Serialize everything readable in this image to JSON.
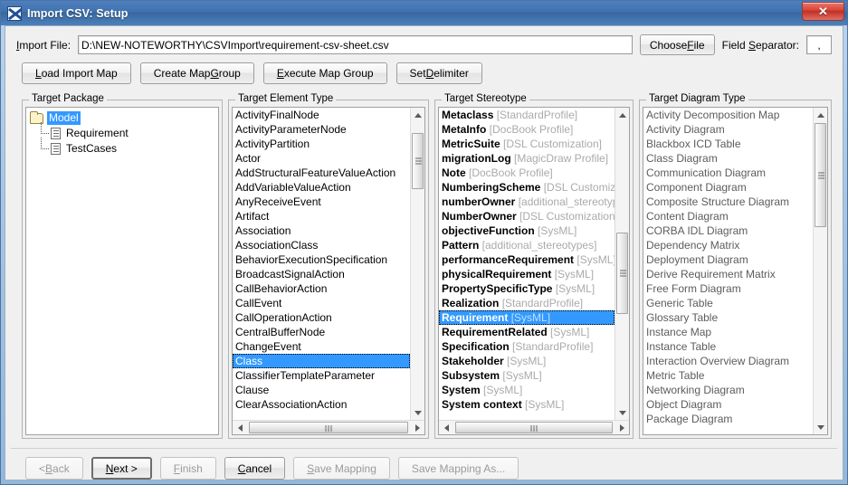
{
  "window": {
    "title": "Import CSV: Setup",
    "icon": "magicdraw-logo-icon",
    "close_label": "✕"
  },
  "form": {
    "import_file_label": "Import File:",
    "import_file_value": "D:\\NEW-NOTEWORTHY\\CSVImport\\requirement-csv-sheet.csv",
    "import_file_placeholder": "",
    "choose_file_label": "Choose File",
    "field_separator_label": "Field Separator:",
    "field_separator_value": ","
  },
  "toolbar": {
    "buttons": [
      {
        "label": "Load Import Map",
        "enabled": true
      },
      {
        "label": "Create Map Group",
        "enabled": true
      },
      {
        "label": "Execute Map Group",
        "enabled": true
      },
      {
        "label": "Set Delimiter",
        "enabled": true
      }
    ]
  },
  "panels": {
    "target_package": {
      "legend": "Target Package",
      "tree": [
        {
          "label": "Model",
          "icon": "folder-icon",
          "selected": true,
          "depth": 0
        },
        {
          "label": "Requirement",
          "icon": "document-icon",
          "selected": false,
          "depth": 1
        },
        {
          "label": "TestCases",
          "icon": "document-icon",
          "selected": false,
          "depth": 1
        }
      ]
    },
    "target_element_type": {
      "legend": "Target Element Type",
      "items": [
        {
          "name": "ActivityFinalNode"
        },
        {
          "name": "ActivityParameterNode"
        },
        {
          "name": "ActivityPartition"
        },
        {
          "name": "Actor"
        },
        {
          "name": "AddStructuralFeatureValueAction"
        },
        {
          "name": "AddVariableValueAction"
        },
        {
          "name": "AnyReceiveEvent"
        },
        {
          "name": "Artifact"
        },
        {
          "name": "Association"
        },
        {
          "name": "AssociationClass"
        },
        {
          "name": "BehaviorExecutionSpecification"
        },
        {
          "name": "BroadcastSignalAction"
        },
        {
          "name": "CallBehaviorAction"
        },
        {
          "name": "CallEvent"
        },
        {
          "name": "CallOperationAction"
        },
        {
          "name": "CentralBufferNode"
        },
        {
          "name": "ChangeEvent"
        },
        {
          "name": "Class",
          "selected": true
        },
        {
          "name": "ClassifierTemplateParameter"
        },
        {
          "name": "Clause"
        },
        {
          "name": "ClearAssociationAction"
        }
      ]
    },
    "target_stereotype": {
      "legend": "Target Stereotype",
      "items": [
        {
          "name": "Metaclass",
          "profile": "[StandardProfile]"
        },
        {
          "name": "MetaInfo",
          "profile": "[DocBook Profile]"
        },
        {
          "name": "MetricSuite",
          "profile": "[DSL Customization]"
        },
        {
          "name": "migrationLog",
          "profile": "[MagicDraw Profile]"
        },
        {
          "name": "Note",
          "profile": "[DocBook Profile]"
        },
        {
          "name": "NumberingScheme",
          "profile": "[DSL Customization]"
        },
        {
          "name": "numberOwner",
          "profile": "[additional_stereotypes]"
        },
        {
          "name": "NumberOwner",
          "profile": "[DSL Customization]"
        },
        {
          "name": "objectiveFunction",
          "profile": "[SysML]"
        },
        {
          "name": "Pattern",
          "profile": "[additional_stereotypes]"
        },
        {
          "name": "performanceRequirement",
          "profile": "[SysML]"
        },
        {
          "name": "physicalRequirement",
          "profile": "[SysML]"
        },
        {
          "name": "PropertySpecificType",
          "profile": "[SysML]"
        },
        {
          "name": "Realization",
          "profile": "[StandardProfile]"
        },
        {
          "name": "Requirement",
          "profile": "[SysML]",
          "selected": true
        },
        {
          "name": "RequirementRelated",
          "profile": "[SysML]"
        },
        {
          "name": "Specification",
          "profile": "[StandardProfile]"
        },
        {
          "name": "Stakeholder",
          "profile": "[SysML]"
        },
        {
          "name": "Subsystem",
          "profile": "[SysML]"
        },
        {
          "name": "System",
          "profile": "[SysML]"
        },
        {
          "name": "System context",
          "profile": "[SysML]"
        }
      ]
    },
    "target_diagram_type": {
      "legend": "Target Diagram Type",
      "disabled": true,
      "items": [
        {
          "name": "Activity Decomposition Map"
        },
        {
          "name": "Activity Diagram"
        },
        {
          "name": "Blackbox ICD Table"
        },
        {
          "name": "Class Diagram"
        },
        {
          "name": "Communication Diagram"
        },
        {
          "name": "Component Diagram"
        },
        {
          "name": "Composite Structure Diagram"
        },
        {
          "name": "Content Diagram"
        },
        {
          "name": "CORBA IDL Diagram"
        },
        {
          "name": "Dependency Matrix"
        },
        {
          "name": "Deployment Diagram"
        },
        {
          "name": "Derive Requirement Matrix"
        },
        {
          "name": "Free Form Diagram"
        },
        {
          "name": "Generic Table"
        },
        {
          "name": "Glossary Table"
        },
        {
          "name": "Instance Map"
        },
        {
          "name": "Instance Table"
        },
        {
          "name": "Interaction Overview Diagram"
        },
        {
          "name": "Metric Table"
        },
        {
          "name": "Networking Diagram"
        },
        {
          "name": "Object Diagram"
        },
        {
          "name": "Package Diagram"
        }
      ]
    }
  },
  "footer": {
    "buttons": [
      {
        "label": "< Back",
        "enabled": false,
        "default": false
      },
      {
        "label": "Next >",
        "enabled": true,
        "default": true
      },
      {
        "label": "Finish",
        "enabled": false,
        "default": false
      },
      {
        "label": "Cancel",
        "enabled": true,
        "default": false
      },
      {
        "label": "Save Mapping",
        "enabled": false,
        "default": false
      },
      {
        "label": "Save Mapping As...",
        "enabled": false,
        "default": false
      }
    ]
  },
  "colors": {
    "selection": "#3399ff",
    "titlebar": "#3f70b0",
    "close": "#c22f23",
    "dialog_bg": "#f0f0f0"
  }
}
